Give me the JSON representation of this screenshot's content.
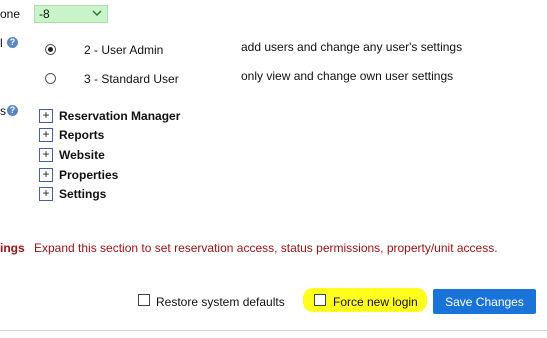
{
  "timezone": {
    "label_fragment": "one",
    "selected_value": "-8"
  },
  "access_level": {
    "label_fragment": "l",
    "options": [
      {
        "label": "2 - User Admin",
        "description": "add users and change any user's settings",
        "selected": true
      },
      {
        "label": "3 - Standard User",
        "description": "only view and change own user settings",
        "selected": false
      }
    ]
  },
  "permissions": {
    "label_fragment": "s",
    "sections": [
      {
        "label": "Reservation Manager",
        "toggle": "+"
      },
      {
        "label": "Reports",
        "toggle": "+"
      },
      {
        "label": "Website",
        "toggle": "+"
      },
      {
        "label": "Properties",
        "toggle": "+"
      },
      {
        "label": "Settings",
        "toggle": "+"
      }
    ]
  },
  "settings_section": {
    "label_fragment": "ings",
    "note": "Expand this section to set reservation access, status permissions, property/unit access."
  },
  "footer": {
    "restore_label": "Restore system defaults",
    "force_login_label": "Force new login",
    "save_label": "Save Changes"
  },
  "colors": {
    "timezone_select_bg": "#c9f3c9",
    "highlight": "#ffff1e",
    "save_button": "#1a73d8",
    "note_text": "#9b1010"
  }
}
